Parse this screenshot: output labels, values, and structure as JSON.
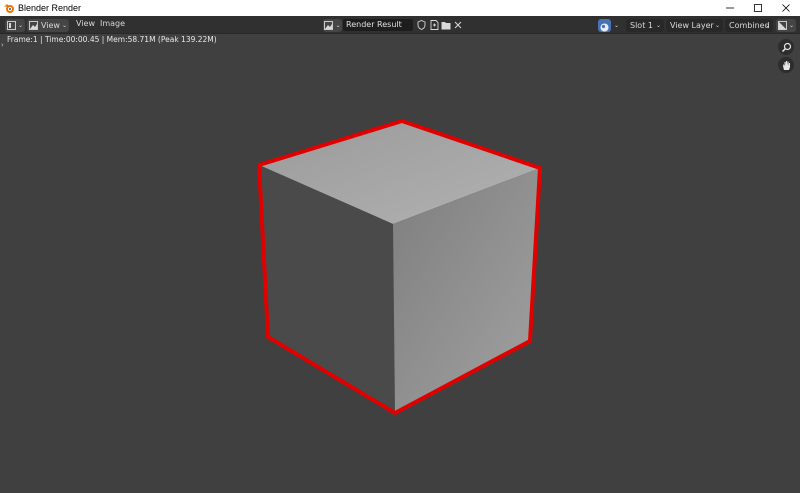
{
  "window": {
    "title": "Blender Render",
    "icon": "blender-logo-icon",
    "controls": [
      "minimize-icon",
      "maximize-icon",
      "close-icon"
    ]
  },
  "header": {
    "editor_type_icon": "image-editor-icon",
    "view_mode_icon": "view-mode-icon",
    "view_mode_label": "View",
    "menus": [
      "View",
      "Image"
    ],
    "image_name": "Render Result",
    "image_icons": [
      "fake-user-shield-icon",
      "new-image-icon",
      "open-folder-icon",
      "unlink-x-icon"
    ],
    "slot": "Slot 1",
    "view_layer": "View Layer",
    "render_pass": "Combined",
    "display_icon": "display-channels-icon"
  },
  "info": {
    "frame": "Frame:1 | Time:00:00.45 | Mem:58.71M (Peak 139.22M)"
  },
  "nav": [
    "zoom-icon",
    "hand-pan-icon"
  ],
  "colors": {
    "background": "#404040",
    "header": "#303030",
    "accent": "#4772b3",
    "outline": "#e00000",
    "cube_top": "#a8a8a8",
    "cube_left": "#4a4a4a",
    "cube_right": "#8e8e8e"
  }
}
